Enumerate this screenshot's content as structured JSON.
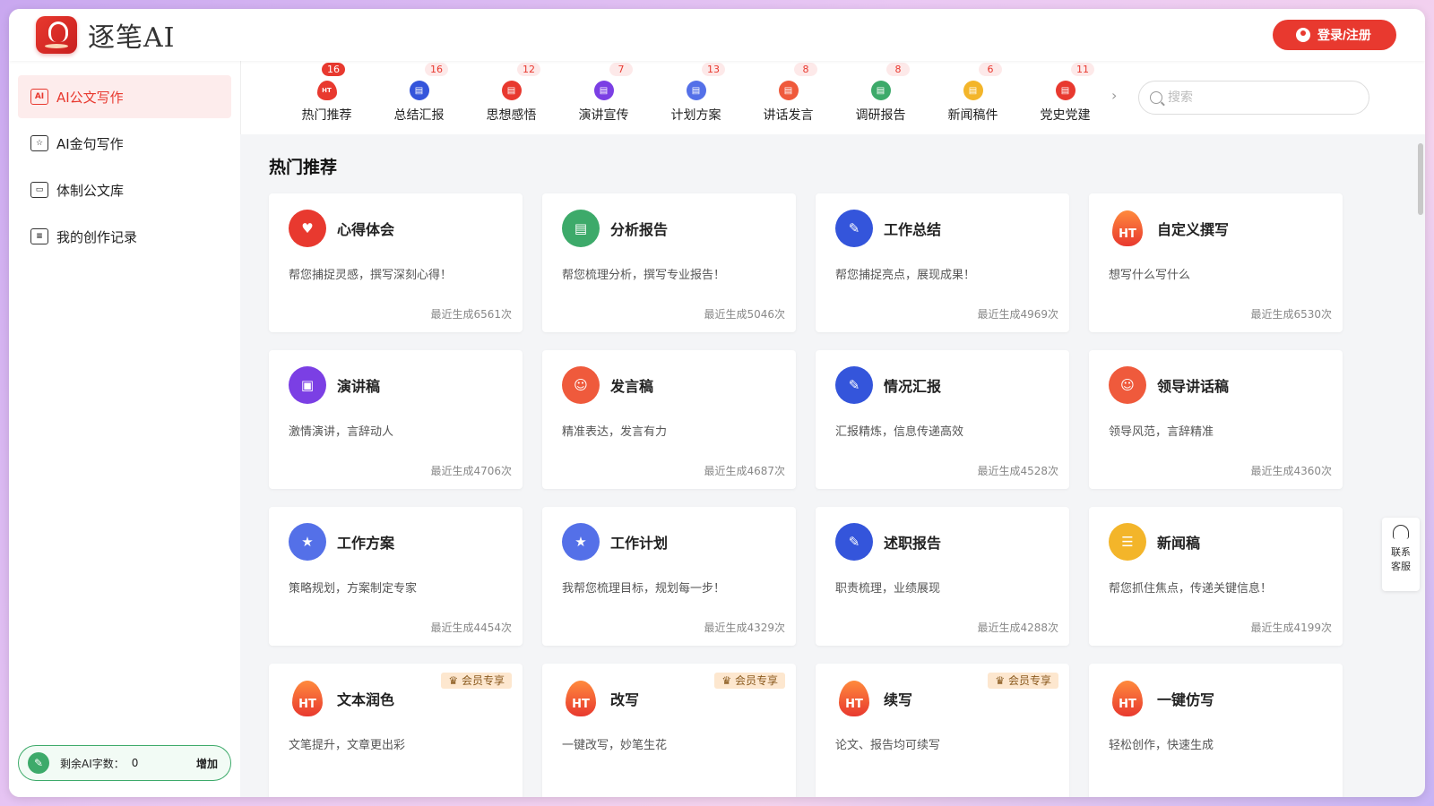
{
  "app": {
    "name": "逐笔AI"
  },
  "header": {
    "login_label": "登录/注册"
  },
  "sidebar": {
    "items": [
      {
        "label": "AI公文写作",
        "icon": "ai-doc-icon",
        "active": true
      },
      {
        "label": "AI金句写作",
        "icon": "star-doc-icon",
        "active": false
      },
      {
        "label": "体制公文库",
        "icon": "folder-icon",
        "active": false
      },
      {
        "label": "我的创作记录",
        "icon": "record-icon",
        "active": false
      }
    ],
    "quota": {
      "label": "剩余AI字数：",
      "value": "0",
      "add_label": "增加"
    }
  },
  "categories": [
    {
      "label": "热门推荐",
      "badge": "16",
      "color": "#e8392f",
      "hot": true
    },
    {
      "label": "总结汇报",
      "badge": "16",
      "color": "#3455db"
    },
    {
      "label": "思想感悟",
      "badge": "12",
      "color": "#e8392f"
    },
    {
      "label": "演讲宣传",
      "badge": "7",
      "color": "#7b3fe4"
    },
    {
      "label": "计划方案",
      "badge": "13",
      "color": "#5470e8"
    },
    {
      "label": "讲话发言",
      "badge": "8",
      "color": "#ef5a3c"
    },
    {
      "label": "调研报告",
      "badge": "8",
      "color": "#3daa6a"
    },
    {
      "label": "新闻稿件",
      "badge": "6",
      "color": "#f3b52a"
    },
    {
      "label": "党史党建",
      "badge": "11",
      "color": "#e8392f"
    }
  ],
  "search": {
    "placeholder": "搜索"
  },
  "main": {
    "section_title": "热门推荐"
  },
  "cards": [
    {
      "title": "心得体会",
      "desc": "帮您捕捉灵感，撰写深刻心得！",
      "count": "最近生成6561次",
      "icon_color": "#e8392f",
      "icon": "heart-doc-icon",
      "vip": false
    },
    {
      "title": "分析报告",
      "desc": "帮您梳理分析，撰写专业报告！",
      "count": "最近生成5046次",
      "icon_color": "#3daa6a",
      "icon": "report-icon",
      "vip": false
    },
    {
      "title": "工作总结",
      "desc": "帮您捕捉亮点，展现成果！",
      "count": "最近生成4969次",
      "icon_color": "#3455db",
      "icon": "pen-doc-icon",
      "vip": false
    },
    {
      "title": "自定义撰写",
      "desc": "想写什么写什么",
      "count": "最近生成6530次",
      "icon_color": "#e8392f",
      "icon": "fire-icon",
      "vip": false
    },
    {
      "title": "演讲稿",
      "desc": "激情演讲，言辞动人",
      "count": "最近生成4706次",
      "icon_color": "#7b3fe4",
      "icon": "podium-icon",
      "vip": false
    },
    {
      "title": "发言稿",
      "desc": "精准表达，发言有力",
      "count": "最近生成4687次",
      "icon_color": "#ef5a3c",
      "icon": "speaker-icon",
      "vip": false
    },
    {
      "title": "情况汇报",
      "desc": "汇报精炼，信息传递高效",
      "count": "最近生成4528次",
      "icon_color": "#3455db",
      "icon": "pen-doc-icon",
      "vip": false
    },
    {
      "title": "领导讲话稿",
      "desc": "领导风范，言辞精准",
      "count": "最近生成4360次",
      "icon_color": "#ef5a3c",
      "icon": "speaker-icon",
      "vip": false
    },
    {
      "title": "工作方案",
      "desc": "策略规划，方案制定专家",
      "count": "最近生成4454次",
      "icon_color": "#5470e8",
      "icon": "plan-icon",
      "vip": false
    },
    {
      "title": "工作计划",
      "desc": "我帮您梳理目标，规划每一步！",
      "count": "最近生成4329次",
      "icon_color": "#5470e8",
      "icon": "plan-icon",
      "vip": false
    },
    {
      "title": "述职报告",
      "desc": "职责梳理，业绩展现",
      "count": "最近生成4288次",
      "icon_color": "#3455db",
      "icon": "pen-doc-icon",
      "vip": false
    },
    {
      "title": "新闻稿",
      "desc": "帮您抓住焦点，传递关键信息！",
      "count": "最近生成4199次",
      "icon_color": "#f3b52a",
      "icon": "news-icon",
      "vip": false
    },
    {
      "title": "文本润色",
      "desc": "文笔提升，文章更出彩",
      "count": "",
      "icon_color": "#e8392f",
      "icon": "fire-icon",
      "vip": true
    },
    {
      "title": "改写",
      "desc": "一键改写，妙笔生花",
      "count": "",
      "icon_color": "#e8392f",
      "icon": "fire-icon",
      "vip": true
    },
    {
      "title": "续写",
      "desc": "论文、报告均可续写",
      "count": "",
      "icon_color": "#e8392f",
      "icon": "fire-icon",
      "vip": true
    },
    {
      "title": "一键仿写",
      "desc": "轻松创作，快速生成",
      "count": "",
      "icon_color": "#e8392f",
      "icon": "fire-icon",
      "vip": false
    }
  ],
  "vip_label": "♛ 会员专享",
  "fire_text": "HT",
  "service": {
    "line1": "联系",
    "line2": "客服"
  }
}
